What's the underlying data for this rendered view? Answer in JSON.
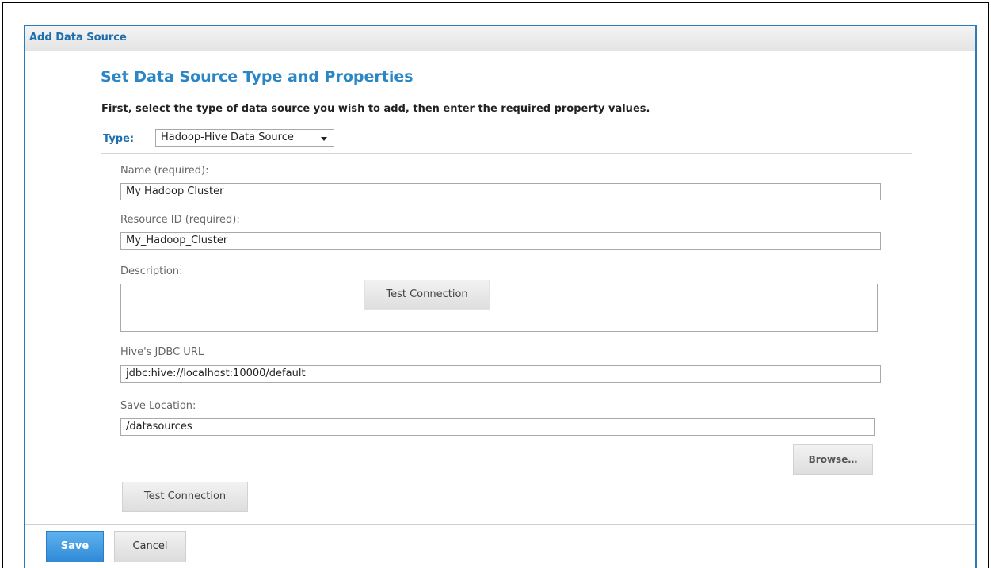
{
  "dialog": {
    "title": "Add Data Source",
    "section_title": "Set Data Source Type and Properties",
    "instructions": "First, select the type of data source you wish to add, then enter the required property values."
  },
  "type_selector": {
    "label": "Type:",
    "selected": "Hadoop-Hive Data Source"
  },
  "fields": {
    "name": {
      "label": "Name (required):",
      "value": "My Hadoop Cluster"
    },
    "resource_id": {
      "label": "Resource ID (required):",
      "value": "My_Hadoop_Cluster"
    },
    "description": {
      "label": "Description:",
      "value": ""
    },
    "jdbc_url": {
      "label": "Hive's JDBC URL",
      "value": "jdbc:hive://localhost:10000/default"
    },
    "save_location": {
      "label": "Save Location:",
      "value": "/datasources"
    }
  },
  "buttons": {
    "test_connection_overlay": "Test Connection",
    "browse": "Browse…",
    "test_connection": "Test Connection",
    "save": "Save",
    "cancel": "Cancel"
  },
  "colors": {
    "accent": "#2b86c6",
    "save_button": "#3b95de"
  }
}
